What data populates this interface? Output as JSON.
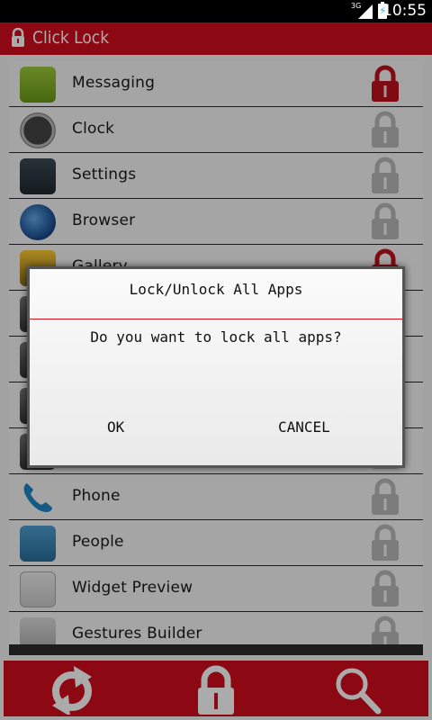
{
  "status_bar": {
    "network": "3G",
    "time": "10:55"
  },
  "app": {
    "title": "Click Lock"
  },
  "colors": {
    "accent": "#d10d1c",
    "lock_on": "#c0111d",
    "lock_off": "#b9b9b9"
  },
  "apps": [
    {
      "name": "Messaging",
      "icon": "messaging-icon",
      "locked": true
    },
    {
      "name": "Clock",
      "icon": "clock-icon",
      "locked": false
    },
    {
      "name": "Settings",
      "icon": "settings-icon",
      "locked": false
    },
    {
      "name": "Browser",
      "icon": "browser-icon",
      "locked": false
    },
    {
      "name": "Gallery",
      "icon": "gallery-icon",
      "locked": true
    },
    {
      "name": "",
      "icon": "app-icon",
      "locked": false
    },
    {
      "name": "",
      "icon": "app-icon",
      "locked": false
    },
    {
      "name": "",
      "icon": "app-icon",
      "locked": false
    },
    {
      "name": "",
      "icon": "app-icon",
      "locked": false
    },
    {
      "name": "Phone",
      "icon": "phone-icon",
      "locked": false
    },
    {
      "name": "People",
      "icon": "people-icon",
      "locked": false
    },
    {
      "name": "Widget Preview",
      "icon": "widget-preview-icon",
      "locked": false
    },
    {
      "name": "Gestures Builder",
      "icon": "gestures-builder-icon",
      "locked": false
    }
  ],
  "dialog": {
    "title": "Lock/Unlock All Apps",
    "message": "Do you want to lock all apps?",
    "ok_label": "OK",
    "cancel_label": "CANCEL"
  },
  "bottom_bar": {
    "refresh_icon": "refresh-icon",
    "lock_icon": "lock-icon",
    "search_icon": "search-icon"
  }
}
